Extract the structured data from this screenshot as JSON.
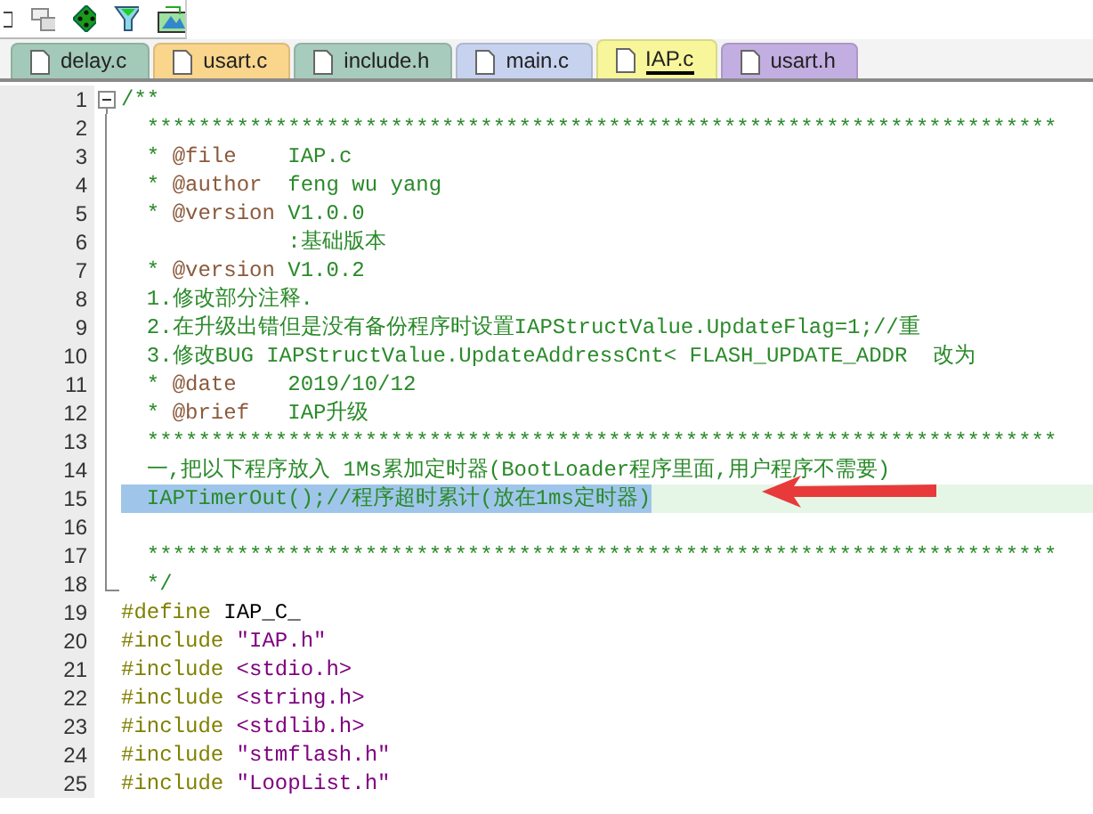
{
  "tabs": [
    {
      "label": "delay.c",
      "selected": false,
      "color": "#a3c9b9"
    },
    {
      "label": "usart.c",
      "selected": false,
      "color": "#fad58c"
    },
    {
      "label": "include.h",
      "selected": false,
      "color": "#a7cbbd"
    },
    {
      "label": "main.c",
      "selected": false,
      "color": "#c7d2ef"
    },
    {
      "label": "IAP.c",
      "selected": true,
      "color": "#f8f69a"
    },
    {
      "label": "usart.h",
      "selected": false,
      "color": "#c3aee2"
    }
  ],
  "lines": [
    {
      "number": "1",
      "fold_start": true,
      "selected": false,
      "tokens": [
        {
          "kind": "comment",
          "text": "/**"
        }
      ]
    },
    {
      "number": "2",
      "selected": false,
      "tokens": [
        {
          "kind": "comment",
          "text": "  ***********************************************************************"
        }
      ]
    },
    {
      "number": "3",
      "selected": false,
      "tokens": [
        {
          "kind": "comment",
          "text": "  * "
        },
        {
          "kind": "tag",
          "text": "@file"
        },
        {
          "kind": "comment",
          "text": "    IAP.c"
        }
      ]
    },
    {
      "number": "4",
      "selected": false,
      "tokens": [
        {
          "kind": "comment",
          "text": "  * "
        },
        {
          "kind": "tag",
          "text": "@author"
        },
        {
          "kind": "comment",
          "text": "  feng wu yang"
        }
      ]
    },
    {
      "number": "5",
      "selected": false,
      "tokens": [
        {
          "kind": "comment",
          "text": "  * "
        },
        {
          "kind": "tag",
          "text": "@version"
        },
        {
          "kind": "comment",
          "text": " V1.0.0"
        }
      ]
    },
    {
      "number": "6",
      "selected": false,
      "tokens": [
        {
          "kind": "comment",
          "text": "             :基础版本"
        }
      ]
    },
    {
      "number": "7",
      "selected": false,
      "tokens": [
        {
          "kind": "comment",
          "text": "  * "
        },
        {
          "kind": "tag",
          "text": "@version"
        },
        {
          "kind": "comment",
          "text": " V1.0.2"
        }
      ]
    },
    {
      "number": "8",
      "selected": false,
      "tokens": [
        {
          "kind": "comment",
          "text": "  1.修改部分注释."
        }
      ]
    },
    {
      "number": "9",
      "selected": false,
      "tokens": [
        {
          "kind": "comment",
          "text": "  2.在升级出错但是没有备份程序时设置IAPStructValue.UpdateFlag=1;//重"
        }
      ]
    },
    {
      "number": "10",
      "selected": false,
      "tokens": [
        {
          "kind": "comment",
          "text": "  3.修改BUG IAPStructValue.UpdateAddressCnt< FLASH_UPDATE_ADDR  改为"
        }
      ]
    },
    {
      "number": "11",
      "selected": false,
      "tokens": [
        {
          "kind": "comment",
          "text": "  * "
        },
        {
          "kind": "tag",
          "text": "@date"
        },
        {
          "kind": "comment",
          "text": "    2019/10/12"
        }
      ]
    },
    {
      "number": "12",
      "selected": false,
      "tokens": [
        {
          "kind": "comment",
          "text": "  * "
        },
        {
          "kind": "tag",
          "text": "@brief"
        },
        {
          "kind": "comment",
          "text": "   IAP升级"
        }
      ]
    },
    {
      "number": "13",
      "selected": false,
      "tokens": [
        {
          "kind": "comment",
          "text": "  ***********************************************************************"
        }
      ]
    },
    {
      "number": "14",
      "selected": false,
      "tokens": [
        {
          "kind": "comment",
          "text": "  一,把以下程序放入 1Ms累加定时器(BootLoader程序里面,用户程序不需要)"
        }
      ]
    },
    {
      "number": "15",
      "selected": true,
      "tokens": [
        {
          "kind": "comment",
          "text": "  IAPTimerOut();//程序超时累计(放在1ms定时器)"
        }
      ]
    },
    {
      "number": "16",
      "selected": false
    },
    {
      "number": "17",
      "selected": false,
      "tokens": [
        {
          "kind": "comment",
          "text": "  ***********************************************************************"
        }
      ]
    },
    {
      "number": "18",
      "fold_end": true,
      "selected": false,
      "tokens": [
        {
          "kind": "comment",
          "text": "  */"
        }
      ]
    },
    {
      "number": "19",
      "selected": false,
      "tokens": [
        {
          "kind": "preprocessor",
          "text": "#define"
        },
        {
          "kind": "plain",
          "text": " IAP_C_"
        }
      ]
    },
    {
      "number": "20",
      "selected": false,
      "tokens": [
        {
          "kind": "preprocessor",
          "text": "#include"
        },
        {
          "kind": "string",
          "text": " \"IAP.h\""
        }
      ]
    },
    {
      "number": "21",
      "selected": false,
      "tokens": [
        {
          "kind": "preprocessor",
          "text": "#include"
        },
        {
          "kind": "string",
          "text": " <stdio.h>"
        }
      ]
    },
    {
      "number": "22",
      "selected": false,
      "tokens": [
        {
          "kind": "preprocessor",
          "text": "#include"
        },
        {
          "kind": "string",
          "text": " <string.h>"
        }
      ]
    },
    {
      "number": "23",
      "selected": false,
      "tokens": [
        {
          "kind": "preprocessor",
          "text": "#include"
        },
        {
          "kind": "string",
          "text": " <stdlib.h>"
        }
      ]
    },
    {
      "number": "24",
      "selected": false,
      "tokens": [
        {
          "kind": "preprocessor",
          "text": "#include"
        },
        {
          "kind": "string",
          "text": " \"stmflash.h\""
        }
      ]
    },
    {
      "number": "25",
      "selected": false,
      "tokens": [
        {
          "kind": "preprocessor",
          "text": "#include"
        },
        {
          "kind": "string",
          "text": " \"LoopList.h\""
        }
      ]
    }
  ]
}
